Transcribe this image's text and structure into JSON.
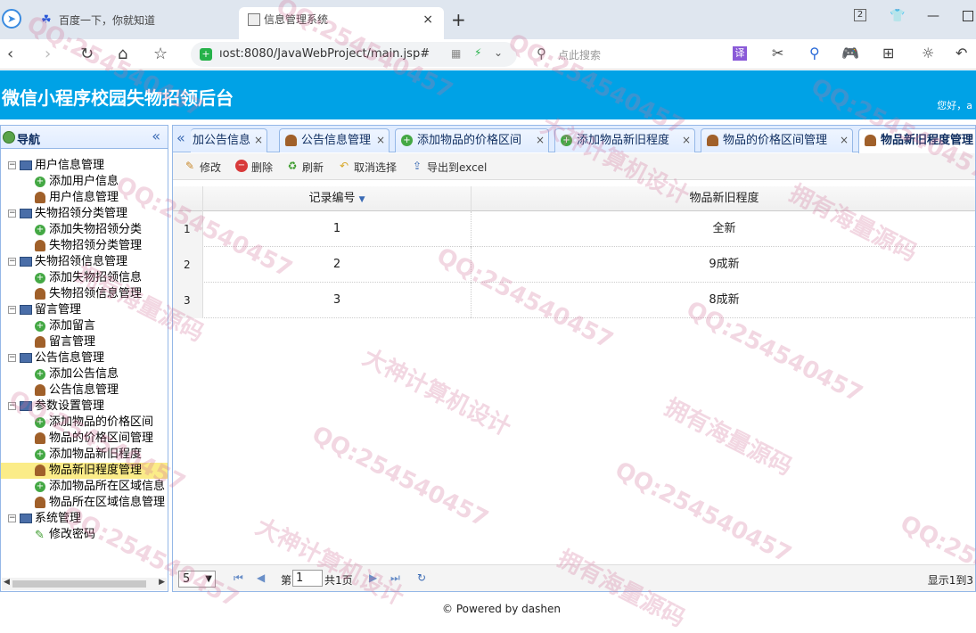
{
  "browser": {
    "tabs": [
      {
        "label": "百度一下，你就知道"
      },
      {
        "label": "信息管理系统",
        "close": "×"
      }
    ],
    "new_tab": "+",
    "tab_count": "2",
    "url": "ıost:8080/JavaWebProject/main.jsp#",
    "search_placeholder": "点此搜索"
  },
  "header": {
    "title": "微信小程序校园失物招领后台",
    "greeting": "您好，a"
  },
  "sidebar": {
    "title": "导航",
    "collapse": "«",
    "groups": [
      {
        "label": "用户信息管理",
        "items": [
          {
            "label": "添加用户信息",
            "icon": "add-icon"
          },
          {
            "label": "用户信息管理",
            "icon": "user-icon"
          }
        ]
      },
      {
        "label": "失物招领分类管理",
        "items": [
          {
            "label": "添加失物招领分类",
            "icon": "add-icon"
          },
          {
            "label": "失物招领分类管理",
            "icon": "user-icon"
          }
        ]
      },
      {
        "label": "失物招领信息管理",
        "items": [
          {
            "label": "添加失物招领信息",
            "icon": "add-icon"
          },
          {
            "label": "失物招领信息管理",
            "icon": "user-icon"
          }
        ]
      },
      {
        "label": "留言管理",
        "items": [
          {
            "label": "添加留言",
            "icon": "add-icon"
          },
          {
            "label": "留言管理",
            "icon": "user-icon"
          }
        ]
      },
      {
        "label": "公告信息管理",
        "items": [
          {
            "label": "添加公告信息",
            "icon": "add-icon"
          },
          {
            "label": "公告信息管理",
            "icon": "user-icon"
          }
        ]
      },
      {
        "label": "参数设置管理",
        "items": [
          {
            "label": "添加物品的价格区间",
            "icon": "add-icon"
          },
          {
            "label": "物品的价格区间管理",
            "icon": "user-icon"
          },
          {
            "label": "添加物品新旧程度",
            "icon": "add-icon"
          },
          {
            "label": "物品新旧程度管理",
            "icon": "user-icon",
            "selected": true
          },
          {
            "label": "添加物品所在区域信息",
            "icon": "add-icon"
          },
          {
            "label": "物品所在区域信息管理",
            "icon": "user-icon"
          }
        ]
      },
      {
        "label": "系统管理",
        "items": [
          {
            "label": "修改密码",
            "icon": "pencil-icon"
          }
        ]
      }
    ]
  },
  "main_tabs": [
    {
      "label": "加公告信息",
      "icon": "add-icon"
    },
    {
      "label": "公告信息管理",
      "icon": "user-icon"
    },
    {
      "label": "添加物品的价格区间",
      "icon": "add-icon"
    },
    {
      "label": "添加物品新旧程度",
      "icon": "add-icon"
    },
    {
      "label": "物品的价格区间管理",
      "icon": "user-icon"
    },
    {
      "label": "物品新旧程度管理",
      "icon": "user-icon",
      "active": true
    }
  ],
  "toolbar": {
    "edit": "修改",
    "delete": "删除",
    "refresh": "刷新",
    "cancel_select": "取消选择",
    "export": "导出到excel"
  },
  "table": {
    "columns": [
      "记录编号",
      "物品新旧程度"
    ],
    "rows": [
      {
        "no": "1",
        "id": "1",
        "value": "全新"
      },
      {
        "no": "2",
        "id": "2",
        "value": "9成新"
      },
      {
        "no": "3",
        "id": "3",
        "value": "8成新"
      }
    ]
  },
  "pager": {
    "page_size": "5",
    "page_prefix": "第",
    "page_value": "1",
    "page_suffix": "共1页",
    "info": "显示1到3"
  },
  "footer": "© Powered by dashen",
  "watermarks": [
    "QQ:254540457",
    "大神计算机设计",
    "拥有海量源码"
  ]
}
